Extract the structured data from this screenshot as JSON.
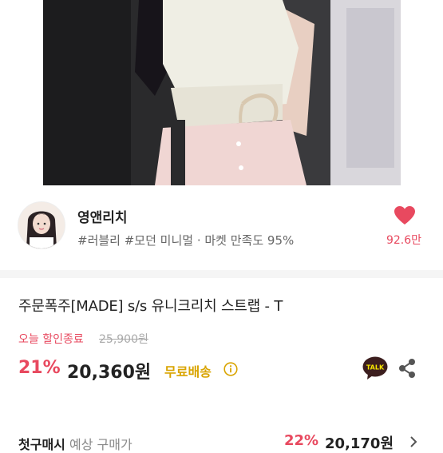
{
  "seller": {
    "name": "영앤리치",
    "tags": "#러블리 #모던 미니멀 · 마켓 만족도 95%",
    "likes": "92.6만"
  },
  "product": {
    "name": "주문폭주[MADE] s/s 유니크리치 스트랩 - T",
    "sale_label": "오늘 할인종료",
    "original_price": "25,900원",
    "discount": "21%",
    "price": "20,360원",
    "shipping": "무료배송"
  },
  "coupon_row": {
    "title": "첫구매시",
    "subtitle": "예상 구매가",
    "discount": "22%",
    "price": "20,170원"
  },
  "colors": {
    "accent": "#e8495f",
    "shipping": "#d9a400",
    "kakao": "#3c1e1e"
  },
  "icons": [
    "heart-icon",
    "info-icon",
    "kakao-talk-icon",
    "share-icon",
    "chevron-right-icon"
  ]
}
